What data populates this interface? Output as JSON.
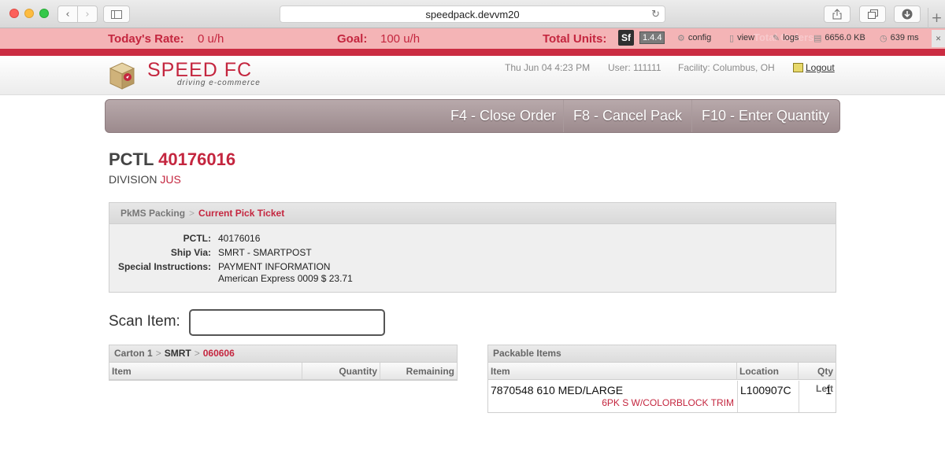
{
  "browser": {
    "url": "speedpack.devvm20"
  },
  "ratebar": {
    "rate_label": "Today's Rate:",
    "rate_value": "0  u/h",
    "goal_label": "Goal:",
    "goal_value": "100  u/h",
    "units_label": "Total Units:",
    "ghost_text": "Total Orders:"
  },
  "symfony": {
    "logo": "Sf",
    "version": "1.4.4",
    "config": "config",
    "view": "view",
    "logs": "logs",
    "memory": "6656.0 KB",
    "time": "639 ms"
  },
  "header": {
    "logo_name": "SPEED FC",
    "logo_tagline": "driving e-commerce",
    "datetime": "Thu Jun 04 4:23 PM",
    "user": "User: 111111",
    "facility": "Facility: Columbus, OH",
    "logout": "Logout"
  },
  "functions": [
    {
      "label": "F4 - Close Order"
    },
    {
      "label": "F8 - Cancel Pack"
    },
    {
      "label": "F10 - Enter Quantity"
    }
  ],
  "pctl": {
    "label": "PCTL",
    "number": "40176016",
    "division_label": "DIVISION",
    "division_code": "JUS"
  },
  "breadcrumb": {
    "root": "PkMS Packing",
    "sep": ">",
    "current": "Current Pick Ticket"
  },
  "details": {
    "pctl_label": "PCTL:",
    "pctl_value": "40176016",
    "shipvia_label": "Ship Via:",
    "shipvia_value": "SMRT - SMARTPOST",
    "instructions_label": "Special Instructions:",
    "instructions_line1": "PAYMENT INFORMATION",
    "instructions_line2": "American Express 0009 $ 23.71"
  },
  "scan": {
    "label": "Scan Item:",
    "value": ""
  },
  "carton": {
    "carton": "Carton 1",
    "sep": ">",
    "carrier": "SMRT",
    "code": "060606",
    "col_item": "Item",
    "col_quantity": "Quantity",
    "col_remaining": "Remaining"
  },
  "packable": {
    "title": "Packable Items",
    "col_item": "Item",
    "col_location": "Location",
    "col_qty_left": "Qty Left",
    "rows": [
      {
        "item": "7870548 610 MED/LARGE",
        "description": "6PK S W/COLORBLOCK TRIM",
        "location": "L100907C",
        "qty_left": "1"
      }
    ]
  },
  "colors": {
    "brand_red": "#c4263f",
    "rate_bar_bg": "#f4b4b6",
    "function_bar": "#a89799"
  },
  "icons": [
    "back-icon",
    "forward-icon",
    "sidebar-icon",
    "reload-icon",
    "share-icon",
    "tabs-icon",
    "download-icon",
    "plus-icon",
    "gear-icon",
    "document-icon",
    "pencil-icon",
    "memory-icon",
    "clock-icon",
    "logout-icon",
    "box-logo-icon"
  ]
}
